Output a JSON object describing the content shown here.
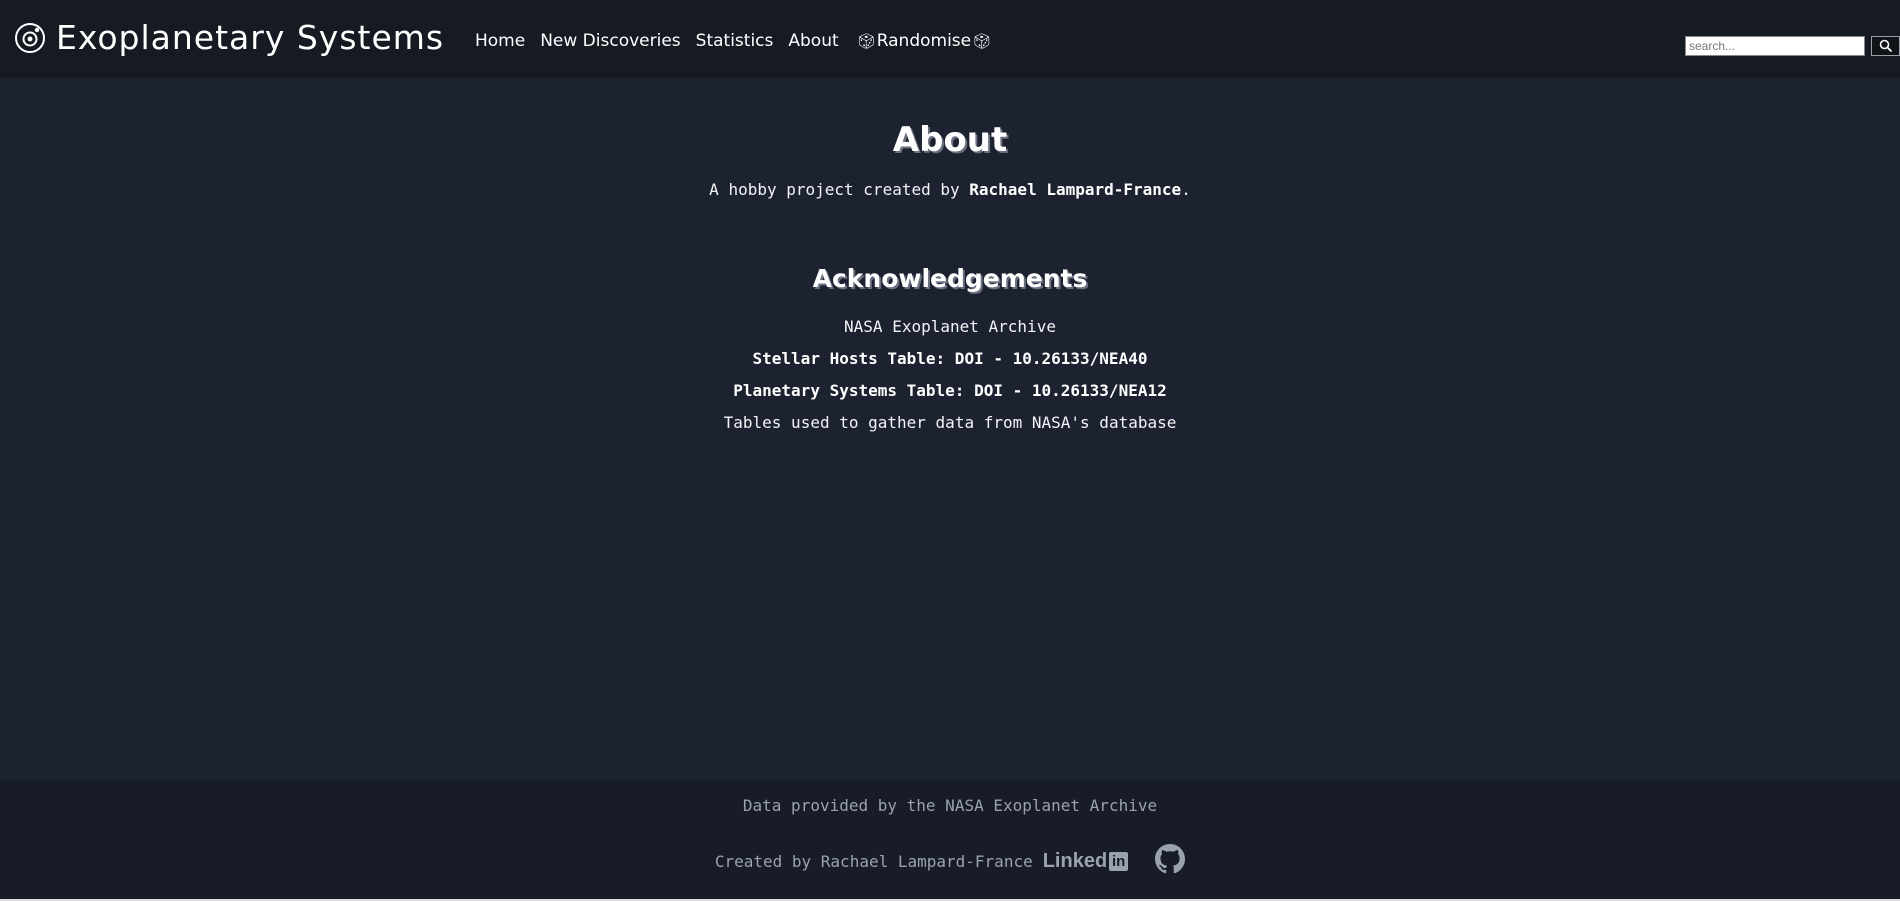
{
  "header": {
    "title": "Exoplanetary Systems",
    "nav": {
      "home": "Home",
      "new_discoveries": "New Discoveries",
      "statistics": "Statistics",
      "about": "About",
      "randomise": "Randomise"
    },
    "search": {
      "placeholder": "search..."
    }
  },
  "main": {
    "heading": "About",
    "intro_prefix": "A hobby project created by ",
    "intro_author": "Rachael Lampard-France",
    "intro_suffix": ".",
    "ack_heading": "Acknowledgements",
    "ack_lines": [
      "NASA Exoplanet Archive",
      "Stellar Hosts Table: DOI - 10.26133/NEA40",
      "Planetary Systems Table: DOI - 10.26133/NEA12",
      "Tables used to gather data from NASA's database"
    ]
  },
  "footer": {
    "data_credit": "Data provided by the NASA Exoplanet Archive",
    "created_by": "Created by Rachael Lampard-France",
    "linkedin_text": "Linked",
    "linkedin_in": "in"
  },
  "icons": {
    "brand": "planet-icon",
    "randomise": "dice-icon",
    "search": "search-icon",
    "linkedin": "linkedin-icon",
    "github": "github-icon"
  },
  "colors": {
    "background": "#1d2230",
    "header_bg": "#161a23",
    "footer_bg": "#181c26",
    "text": "#ffffff",
    "muted": "#9aa2b0"
  }
}
